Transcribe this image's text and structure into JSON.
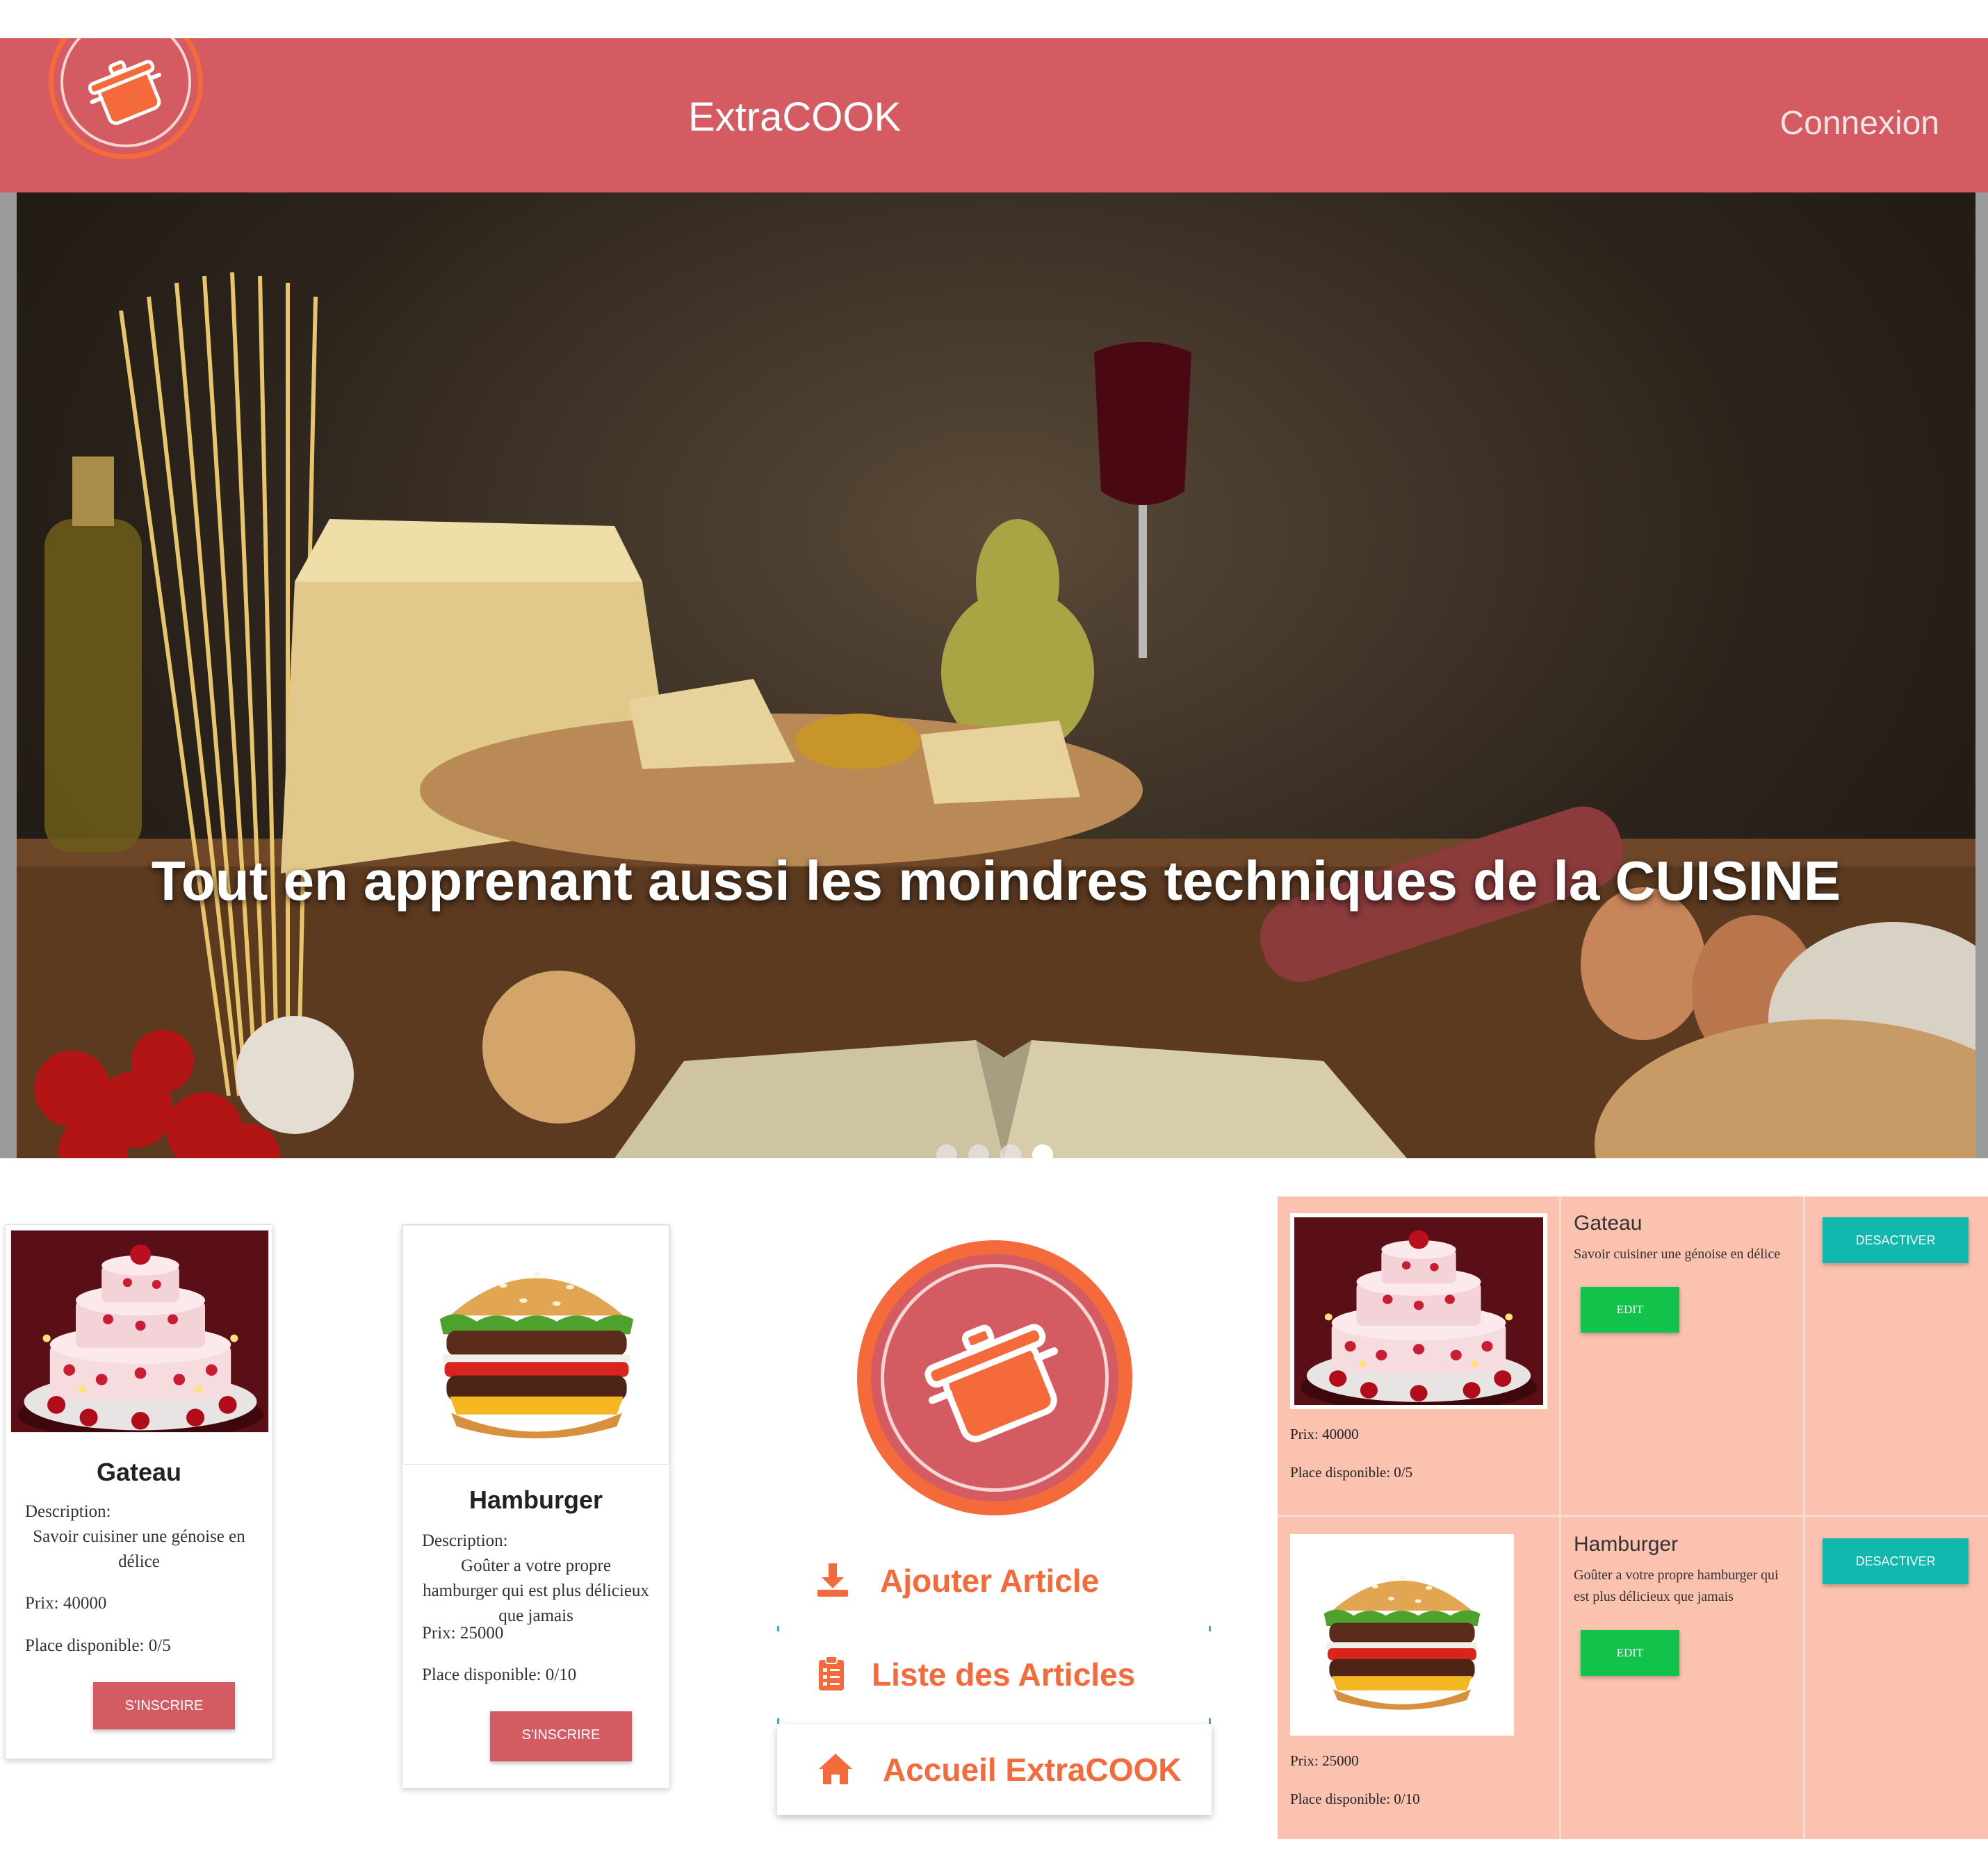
{
  "header": {
    "brand": "ExtraCOOK",
    "login_link": "Connexion",
    "logo_icon": "cooking-pot-icon",
    "bg_color": "#d35b61",
    "accent_color": "#f46a3a"
  },
  "hero": {
    "caption": "Tout en apprenant aussi les moindres techniques de la CUISINE",
    "slide_count": 4,
    "active_slide": 4
  },
  "event_cards": [
    {
      "title": "Gateau",
      "description_label": "Description:",
      "description": "Savoir cuisiner une génoise en délice",
      "price": "Prix: 40000",
      "places": "Place disponible: 0/5",
      "button": "S'INSCRIRE",
      "image": "cake-image"
    },
    {
      "title": "Hamburger",
      "description_label": "Description:",
      "description": "Goûter a votre propre hamburger qui est plus délicieux que jamais",
      "price": "Prix: 25000",
      "places": "Place disponible: 0/10",
      "button": "S'INSCRIRE",
      "image": "burger-image"
    }
  ],
  "side_menu": {
    "logo_icon": "cooking-pot-icon",
    "items": [
      {
        "label": "Ajouter Article",
        "icon": "download-icon"
      },
      {
        "label": "Liste des Articles",
        "icon": "clipboard-list-icon"
      },
      {
        "label": "Accueil ExtraCOOK",
        "icon": "home-icon"
      }
    ]
  },
  "admin_table": {
    "rows": [
      {
        "title": "Gateau",
        "description": "Savoir cuisiner une génoise en délice",
        "price": "Prix: 40000",
        "places": "Place disponible: 0/5",
        "edit_button": "EDIT",
        "toggle_button": "DESACTIVER"
      },
      {
        "title": "Hamburger",
        "description": "Goûter a votre propre hamburger qui est plus délicieux que jamais",
        "price": "Prix: 25000",
        "places": "Place disponible: 0/10",
        "edit_button": "EDIT",
        "toggle_button": "DESACTIVER"
      }
    ]
  },
  "colors": {
    "primary": "#d35b61",
    "orange": "#f46a3a",
    "admin_bg": "#fcc2b0",
    "edit_green": "#11c24b",
    "toggle_teal": "#10b8ad"
  }
}
